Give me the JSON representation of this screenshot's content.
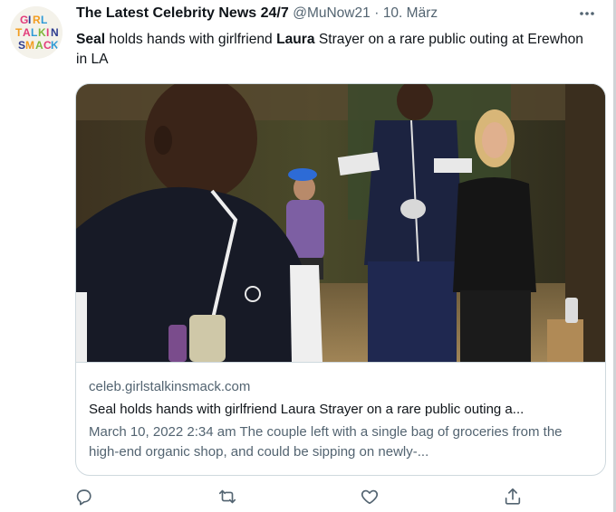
{
  "tweet": {
    "author_name": "The Latest Celebrity News 24/7",
    "handle": "@MuNow21",
    "separator": "·",
    "date": "10. März",
    "text_parts": [
      "Seal",
      " holds hands with girlfriend ",
      "Laura",
      " Strayer on a rare public outing at Erewhon in LA"
    ],
    "avatar": {
      "icon": "brand-logo-avatar",
      "logo_text": "GIRL TALK IN SMACK"
    },
    "more_icon": "more-horizontal-icon"
  },
  "card": {
    "image": {
      "icon": "article-photo",
      "subject": "people walking outdoors"
    },
    "domain": "celeb.girlstalkinsmack.com",
    "title": "Seal holds hands with girlfriend Laura Strayer on a rare public outing a...",
    "description": "March 10, 2022 2:34 am The couple left with a single bag of groceries from the high-end organic shop, and could be sipping on newly-..."
  },
  "actions": [
    {
      "name": "reply",
      "icon": "reply-icon"
    },
    {
      "name": "retweet",
      "icon": "retweet-icon"
    },
    {
      "name": "like",
      "icon": "heart-icon"
    },
    {
      "name": "share",
      "icon": "share-icon"
    }
  ],
  "colors": {
    "text_primary": "#0f1419",
    "text_secondary": "#536471",
    "border": "#cfd9de"
  }
}
